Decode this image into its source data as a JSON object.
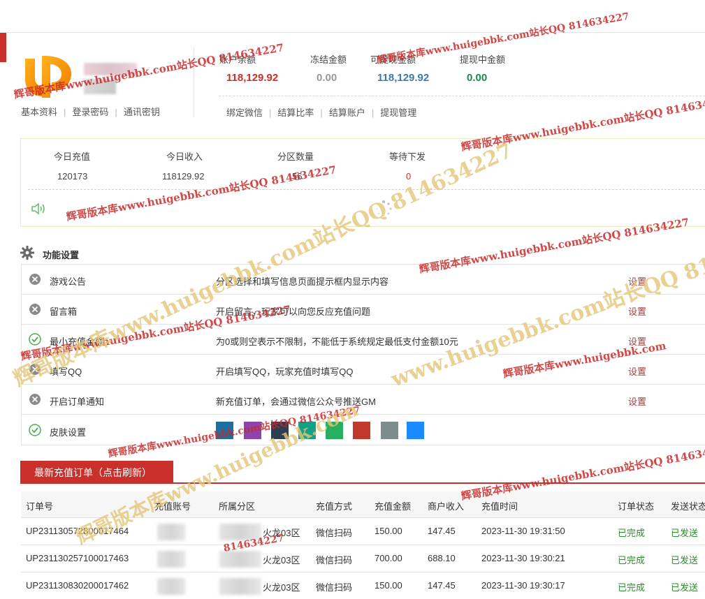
{
  "account": {
    "links_left": [
      "基本资料",
      "登录密码",
      "通讯密钥"
    ],
    "links_right": [
      "绑定微信",
      "结算比率",
      "结算账户",
      "提现管理"
    ]
  },
  "balances": [
    {
      "label": "账户余额",
      "value": "118,129.92",
      "color": "#c9302c"
    },
    {
      "label": "冻结金额",
      "value": "0.00",
      "color": "#999999"
    },
    {
      "label": "可提现金额",
      "value": "118,129.92",
      "color": "#3a7ca8"
    },
    {
      "label": "提现中金额",
      "value": "0.00",
      "color": "#1a8a4a"
    }
  ],
  "stats": [
    {
      "label": "今日充值",
      "value": "120173"
    },
    {
      "label": "今日收入",
      "value": "118129.92"
    },
    {
      "label": "分区数量",
      "value": "56"
    },
    {
      "label": "等待下发",
      "value": "0"
    }
  ],
  "functions": {
    "title": "功能设置",
    "items": [
      {
        "name": "游戏公告",
        "desc": "分区选择和填写信息页面提示框内显示内容",
        "action": "设置",
        "enabled": false
      },
      {
        "name": "留言箱",
        "desc": "开启留言，玩家可以向您反应充值问题",
        "action": "设置",
        "enabled": false
      },
      {
        "name": "最小充值金额",
        "desc": "为0或则空表示不限制，不能低于系统规定最低支付金额10元",
        "action": "设置",
        "enabled": true
      },
      {
        "name": "填写QQ",
        "desc": "开启填写QQ，玩家充值时填写QQ",
        "action": "设置",
        "enabled": false
      },
      {
        "name": "开启订单通知",
        "desc": "新充值订单，会通过微信公众号推送GM",
        "action": "设置",
        "enabled": false
      },
      {
        "name": "皮肤设置",
        "enabled": true
      }
    ],
    "skins": [
      "#1d6fa0",
      "#8e44ad",
      "#2c3e50",
      "#16a085",
      "#27ae60",
      "#c0392b",
      "#7f8c8d",
      "#1a8cff"
    ]
  },
  "orders": {
    "tab_label": "最新充值订单（点击刷新）",
    "headers": [
      "订单号",
      "充值账号",
      "所属分区",
      "充值方式",
      "充值金额",
      "商户收入",
      "充值时间",
      "订单状态",
      "发送状态"
    ],
    "rows": [
      {
        "order_no": "UP231130572800017464",
        "zone": "火龙03区",
        "method": "微信扫码",
        "amount": "150.00",
        "income": "147.45",
        "time": "2023-11-30 19:31:50",
        "status": "已完成",
        "send": "已发送"
      },
      {
        "order_no": "UP231130257100017463",
        "zone": "火龙03区",
        "method": "微信扫码",
        "amount": "700.00",
        "income": "688.10",
        "time": "2023-11-30 19:30:21",
        "status": "已完成",
        "send": "已发送"
      },
      {
        "order_no": "UP231130830200017462",
        "zone": "火龙03区",
        "method": "微信扫码",
        "amount": "150.00",
        "income": "147.45",
        "time": "2023-11-30 19:30:17",
        "status": "已完成",
        "send": "已发送"
      }
    ]
  },
  "watermarks": {
    "a": "辉哥版本库www.huigebbk.com站长QQ 814634227",
    "b": "辉哥版本库www.huigebbk.com",
    "c": "www.huigebbk.com站长QQ 814634227",
    "d": "辉哥版本库",
    "e": "814634227"
  }
}
